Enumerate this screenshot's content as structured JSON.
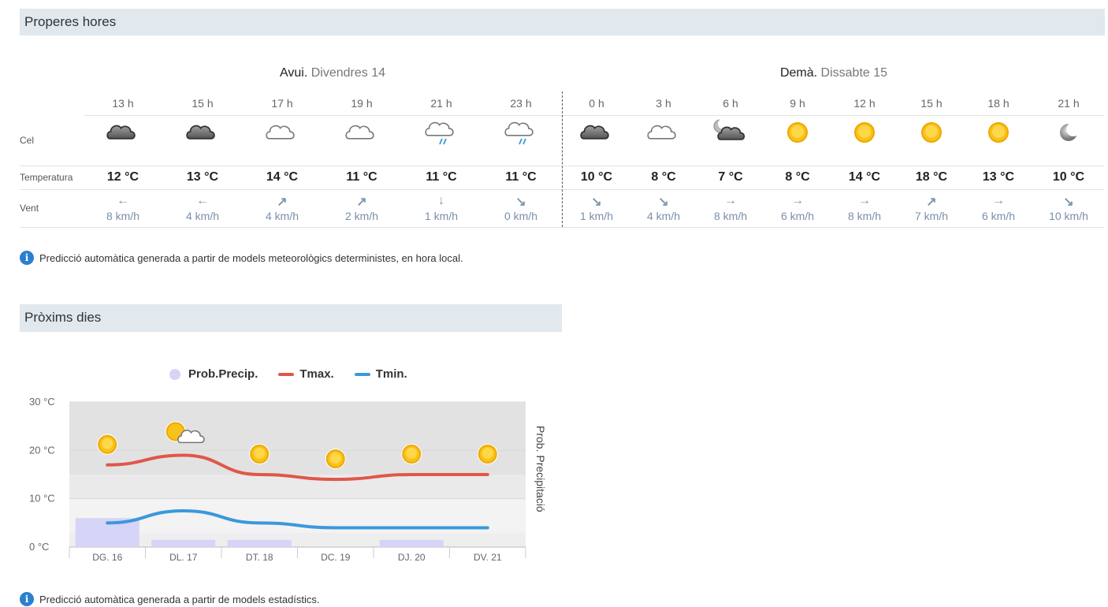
{
  "hourly": {
    "title": "Properes hores",
    "today_label": "Avui.",
    "today_date": "Divendres 14",
    "tomorrow_label": "Demà.",
    "tomorrow_date": "Dissabte 15",
    "row_labels": {
      "sky": "Cel",
      "temperature": "Temperatura",
      "wind": "Vent"
    },
    "hours": [
      {
        "hour": "13 h",
        "icon": "cloudy-dark-icon",
        "temp": "12 °C",
        "dir": "west",
        "wind": "8 km/h"
      },
      {
        "hour": "15 h",
        "icon": "cloudy-dark-icon",
        "temp": "13 °C",
        "dir": "west",
        "wind": "4 km/h"
      },
      {
        "hour": "17 h",
        "icon": "cloud-outline-icon",
        "temp": "14 °C",
        "dir": "north-east",
        "wind": "4 km/h"
      },
      {
        "hour": "19 h",
        "icon": "cloud-outline-icon",
        "temp": "11 °C",
        "dir": "north-east",
        "wind": "2 km/h"
      },
      {
        "hour": "21 h",
        "icon": "cloud-rain-icon",
        "temp": "11 °C",
        "dir": "south",
        "wind": "1 km/h"
      },
      {
        "hour": "23 h",
        "icon": "cloud-rain-icon",
        "temp": "11 °C",
        "dir": "south-east",
        "wind": "0 km/h"
      },
      {
        "hour": "0 h",
        "icon": "cloudy-dark-icon",
        "temp": "10 °C",
        "dir": "south-east",
        "wind": "1 km/h"
      },
      {
        "hour": "3 h",
        "icon": "cloud-outline-icon",
        "temp": "8 °C",
        "dir": "south-east",
        "wind": "4 km/h"
      },
      {
        "hour": "6 h",
        "icon": "moon-cloud-icon",
        "temp": "7 °C",
        "dir": "east",
        "wind": "8 km/h"
      },
      {
        "hour": "9 h",
        "icon": "sun-icon",
        "temp": "8 °C",
        "dir": "east",
        "wind": "6 km/h"
      },
      {
        "hour": "12 h",
        "icon": "sun-icon",
        "temp": "14 °C",
        "dir": "east",
        "wind": "8 km/h"
      },
      {
        "hour": "15 h",
        "icon": "sun-icon",
        "temp": "18 °C",
        "dir": "north-east",
        "wind": "7 km/h"
      },
      {
        "hour": "18 h",
        "icon": "sun-icon",
        "temp": "13 °C",
        "dir": "east",
        "wind": "6 km/h"
      },
      {
        "hour": "21 h",
        "icon": "moon-icon",
        "temp": "10 °C",
        "dir": "south-east",
        "wind": "10 km/h"
      }
    ],
    "note": "Predicció automàtica generada a partir de models meteorològics deterministes, en hora local."
  },
  "daily": {
    "title": "Pròxims dies",
    "legend": {
      "precip": "Prob.Precip.",
      "tmax": "Tmax.",
      "tmin": "Tmin."
    },
    "right_axis_label": "Prob. Precipitació",
    "note": "Predicció automàtica generada a partir de models estadístics.",
    "colors": {
      "tmax": "#e0574a",
      "tmin": "#3b98dc",
      "precip": "#d6d4f7"
    }
  },
  "chart_data": {
    "type": "line",
    "categories": [
      "DG. 16",
      "DL. 17",
      "DT. 18",
      "DC. 19",
      "DJ. 20",
      "DV. 21"
    ],
    "y_ticks": [
      "30 °C",
      "20 °C",
      "10 °C",
      "0 °C"
    ],
    "ylim": [
      0,
      30
    ],
    "series": [
      {
        "name": "Tmax.",
        "values": [
          17,
          19,
          15,
          14,
          15,
          15
        ]
      },
      {
        "name": "Tmin.",
        "values": [
          5,
          7.5,
          5,
          4,
          4,
          4
        ]
      },
      {
        "name": "Prob.Precip.",
        "values": [
          20,
          5,
          5,
          0,
          5,
          0
        ]
      }
    ],
    "day_icons": [
      "sun-icon",
      "sun-cloud-icon",
      "sun-icon",
      "sun-icon",
      "sun-icon",
      "sun-icon"
    ]
  }
}
